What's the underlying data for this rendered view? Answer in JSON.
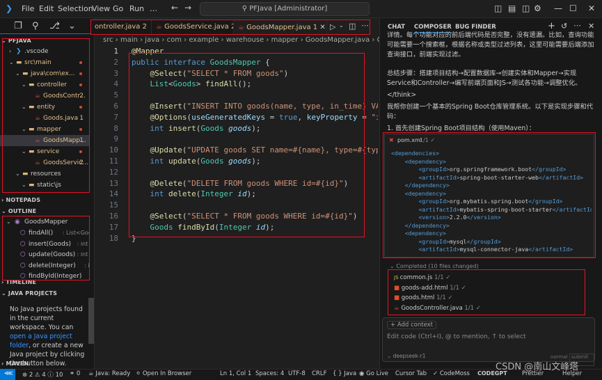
{
  "titlebar": {
    "menus": [
      "File",
      "Edit",
      "Selection",
      "View",
      "Go",
      "Run",
      "…"
    ],
    "search": "PFJava [Administrator]"
  },
  "sidebar": {
    "project": "PFJAVA",
    "tree": [
      {
        "label": ".vscode",
        "kind": "vscode",
        "indent": 1
      },
      {
        "label": "src\\main",
        "kind": "folder",
        "indent": 1,
        "dot": true
      },
      {
        "label": "java\\com\\ex...",
        "kind": "folder",
        "indent": 2,
        "dot": true
      },
      {
        "label": "controller",
        "kind": "folder",
        "indent": 3,
        "dot": true
      },
      {
        "label": "GoodsContr...",
        "kind": "java",
        "indent": 4,
        "badge": "2"
      },
      {
        "label": "entity",
        "kind": "folder",
        "indent": 3,
        "dot": true
      },
      {
        "label": "Goods.java",
        "kind": "java",
        "indent": 4,
        "badge": "1"
      },
      {
        "label": "mapper",
        "kind": "folder",
        "indent": 3,
        "dot": true
      },
      {
        "label": "GoodsMapp...",
        "kind": "java",
        "indent": 4,
        "badge": "1",
        "selected": true
      },
      {
        "label": "service",
        "kind": "folder",
        "indent": 3,
        "dot": true
      },
      {
        "label": "GoodsServic...",
        "kind": "java",
        "indent": 4,
        "badge": "2"
      },
      {
        "label": "resources",
        "kind": "folder",
        "indent": 2
      },
      {
        "label": "static\\js",
        "kind": "folder",
        "indent": 3
      }
    ],
    "notepads": "NOTEPADS",
    "outline": "OUTLINE",
    "outline_root": "GoodsMapper",
    "outline_items": [
      {
        "name": "findAll()",
        "sig": ": List<Goods>"
      },
      {
        "name": "insert(Goods)",
        "sig": ": int"
      },
      {
        "name": "update(Goods)",
        "sig": ": int"
      },
      {
        "name": "delete(Integer)",
        "sig": ": int"
      },
      {
        "name": "findById(Integer)",
        "sig": ""
      }
    ],
    "timeline": "TIMELINE",
    "java_projects": "JAVA PROJECTS",
    "msg_1": "No Java projects found in the current workspace. You can",
    "msg_link1": "open a Java project folder",
    "msg_2": ", or create a new Java project by clicking the button below.",
    "maven": "MAVEN"
  },
  "editor": {
    "tabs": [
      {
        "label": "ontroller.java",
        "badge": "2"
      },
      {
        "label": "GoodsService.java",
        "badge": "2"
      },
      {
        "label": "GoodsMapper.java",
        "badge": "1",
        "active": true
      }
    ],
    "breadcrumb": "src › main › java › com › example › warehouse › mapper › GoodsMapper.java › Good",
    "lines": [
      "@Mapper",
      "public interface GoodsMapper {",
      "    @Select(\"SELECT * FROM goods\")",
      "    List<Goods> findAll();",
      "",
      "    @Insert(\"INSERT INTO goods(name, type, in_time) VAL",
      "    @Options(useGeneratedKeys = true, keyProperty = \"id",
      "    int insert(Goods goods);",
      "",
      "    @Update(\"UPDATE goods SET name=#{name}, type=#{type",
      "    int update(Goods goods);",
      "",
      "    @Delete(\"DELETE FROM goods WHERE id=#{id}\")",
      "    int delete(Integer id);",
      "",
      "    @Select(\"SELECT * FROM goods WHERE id=#{id}\")",
      "    Goods findById(Integer id);",
      "}"
    ]
  },
  "chat": {
    "tabs": [
      "CHAT",
      "COMPOSER",
      "BUG FINDER"
    ],
    "p1": "详情。每个功能对应的前后端代码是否完整，没有遗漏。比如，查询功能可能需要一个搜索框，根据名称或类型过滤列表，这里可能需要后端添加查询接口，前端实现过滤。",
    "p2": "总结步骤：搭建项目结构→配置数据库→创建实体和Mapper→实现Service和Controller→编写前端页面和JS→测试各功能→调整优化。",
    "think_end": "</think>",
    "p3": "我帮你创建一个基本的Spring Boot仓库管理系统。以下是实现步骤和代码：",
    "step1": "1. 首先创建Spring Boot项目结构（使用Maven）：",
    "xml_file": "pom.xml",
    "xml_count": "1/1 ✓",
    "xml_lines": [
      "<dependencies>",
      "    <dependency>",
      "        <groupId>org.springframework.boot</groupId>",
      "        <artifactId>spring-boot-starter-web</artifactId>",
      "    </dependency>",
      "    <dependency>",
      "        <groupId>org.mybatis.spring.boot</groupId>",
      "        <artifactId>mybatis-spring-boot-starter</artifactId>",
      "        <version>2.2.0</version>",
      "    </dependency>",
      "    <dependency>",
      "        <groupId>mysql</groupId>",
      "        <artifactId>mysql-connector-java</artifactId>"
    ],
    "completed": "Completed (10 files changed)",
    "files": [
      {
        "name": "common.js",
        "count": "1/1 ✓",
        "kind": "js"
      },
      {
        "name": "goods-add.html",
        "count": "1/1 ✓",
        "kind": "html"
      },
      {
        "name": "goods.html",
        "count": "1/1 ✓",
        "kind": "html"
      },
      {
        "name": "GoodsController.java",
        "count": "1/1 ✓",
        "kind": "java"
      }
    ],
    "add_context": "+ Add context",
    "input_placeholder": "Edit code (Ctrl+I), @ to mention, ↑ to select",
    "model": "deepseek-r1",
    "mode": "normal",
    "submit": "submit ↵"
  },
  "statusbar": {
    "problems": "⊗ 2 ⚠ 4 ⓘ 10",
    "ports": "⚭ 0",
    "java": "Java: Ready",
    "browser": "Open In Browser",
    "position": "Ln 1, Col 1",
    "spaces": "Spaces: 4",
    "encoding": "UTF-8",
    "eol": "CRLF",
    "lang": "{ } Java",
    "golive": "Go Live",
    "cursortab": "Cursor Tab",
    "codemoss": "CodeMoss",
    "codegpt": "CODEGPT",
    "prettier": "Prettier",
    "helper": "Helper"
  },
  "watermark": "CSDN @南山文峰塔"
}
